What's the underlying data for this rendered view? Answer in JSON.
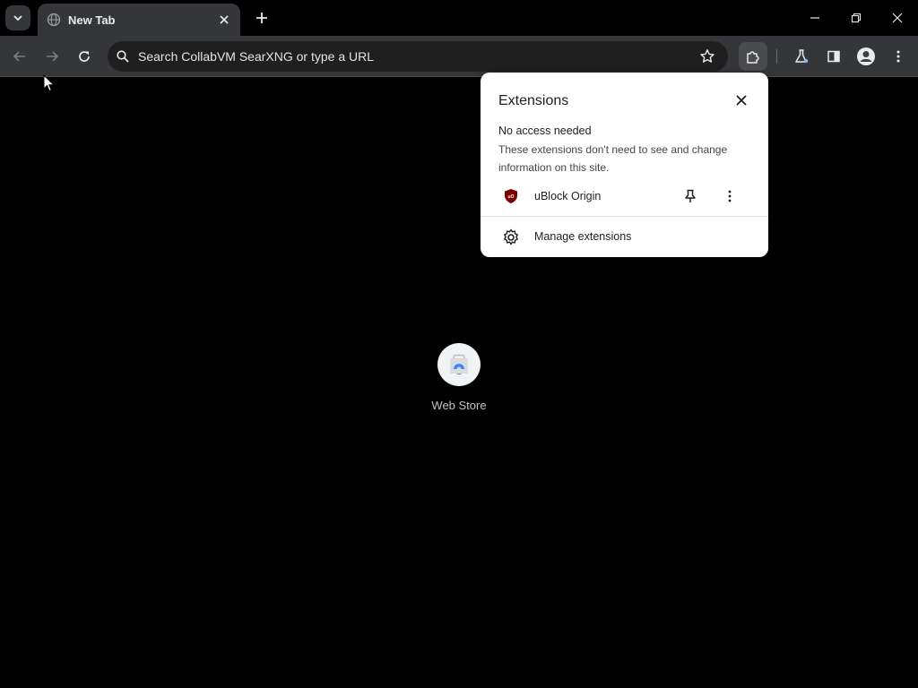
{
  "tabstrip": {
    "tab_title": "New Tab",
    "icons": [
      "chevron-down-icon",
      "globe-icon",
      "close-icon",
      "plus-icon",
      "minimize-icon",
      "restore-icon",
      "close-window-icon"
    ]
  },
  "toolbar": {
    "omnibox_text": "Search CollabVM SearXNG or type a URL",
    "icons": [
      "back-icon",
      "forward-icon",
      "reload-icon",
      "search-icon",
      "star-icon",
      "puzzle-icon",
      "labs-flask-icon",
      "side-panel-icon",
      "profile-icon",
      "kebab-menu-icon"
    ]
  },
  "content": {
    "shortcut_label": "Web Store"
  },
  "extensions_popup": {
    "title": "Extensions",
    "section_title": "No access needed",
    "section_desc": "These extensions don't need to see and change information on this site.",
    "extensions": [
      {
        "name": "uBlock Origin",
        "icon": "ublock-shield-icon"
      }
    ],
    "manage_label": "Manage extensions"
  },
  "colors": {
    "chrome_bg": "#35363a",
    "page_bg": "#000000",
    "popup_bg": "#ffffff",
    "ublock_red": "#800000"
  }
}
